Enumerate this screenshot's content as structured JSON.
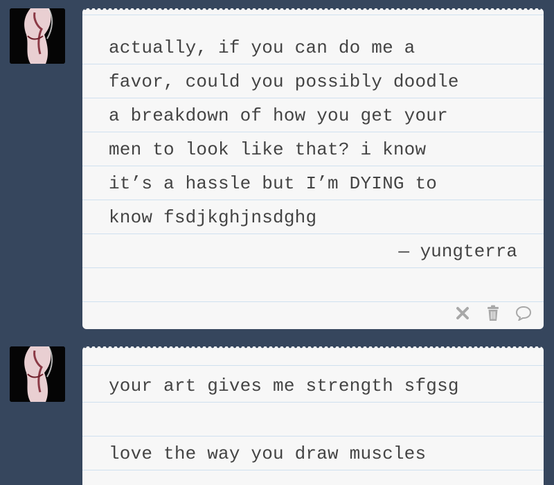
{
  "colors": {
    "background": "#36465d",
    "card": "#f7f7f7",
    "rule_line": "#cfe0ef",
    "text": "#444444",
    "icon": "#a8a8a8"
  },
  "posts": [
    {
      "avatar_icon": "user-avatar-icon",
      "lines": [
        "actually, if you can do me a",
        "favor, could you possibly doodle",
        "a breakdown of how you get your",
        "men to look like that? i know",
        "it’s a hassle but I’m DYING to",
        "know fsdjkghjnsdghg"
      ],
      "signature": "— yungterra",
      "controls": [
        "close-icon",
        "trash-icon",
        "reply-icon"
      ]
    },
    {
      "avatar_icon": "user-avatar-icon",
      "lines": [
        "your art gives me strength sfgsg",
        "",
        "love the way you draw muscles"
      ]
    }
  ]
}
